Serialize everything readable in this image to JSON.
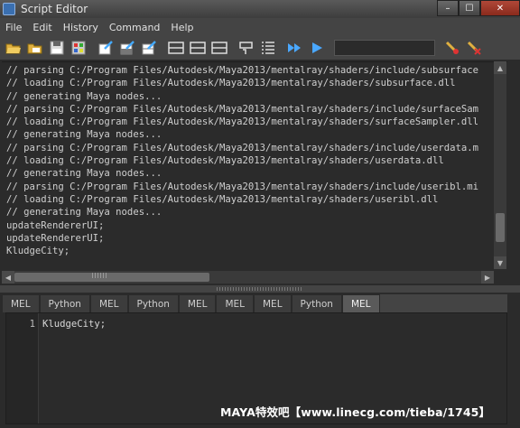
{
  "window": {
    "title": "Script Editor",
    "controls": [
      "–",
      "☐",
      "✕"
    ]
  },
  "menubar": [
    "File",
    "Edit",
    "History",
    "Command",
    "Help"
  ],
  "toolbar": {
    "icons": [
      "open-script-icon",
      "source-script-icon",
      "save-script-icon",
      "save-to-shelf-icon",
      "clear-history-icon",
      "clear-input-icon",
      "clear-all-icon",
      "show-history-only-icon",
      "show-input-only-icon",
      "show-both-icon",
      "echo-all-commands-icon",
      "show-line-numbers-icon",
      "execute-all-icon",
      "execute-icon",
      "search-field",
      "search-icon",
      "search-clear-icon"
    ]
  },
  "history": {
    "lines": [
      "// parsing C:/Program Files/Autodesk/Maya2013/mentalray/shaders/include/subsurface",
      "// loading C:/Program Files/Autodesk/Maya2013/mentalray/shaders/subsurface.dll",
      "// generating Maya nodes...",
      "// parsing C:/Program Files/Autodesk/Maya2013/mentalray/shaders/include/surfaceSam",
      "// loading C:/Program Files/Autodesk/Maya2013/mentalray/shaders/surfaceSampler.dll",
      "// generating Maya nodes...",
      "// parsing C:/Program Files/Autodesk/Maya2013/mentalray/shaders/include/userdata.m",
      "// loading C:/Program Files/Autodesk/Maya2013/mentalray/shaders/userdata.dll",
      "// generating Maya nodes...",
      "// parsing C:/Program Files/Autodesk/Maya2013/mentalray/shaders/include/useribl.mi",
      "// loading C:/Program Files/Autodesk/Maya2013/mentalray/shaders/useribl.dll",
      "// generating Maya nodes...",
      "updateRendererUI;",
      "updateRendererUI;",
      "KludgeCity;"
    ]
  },
  "tabs": [
    "MEL",
    "Python",
    "MEL",
    "Python",
    "MEL",
    "MEL",
    "MEL",
    "Python",
    "MEL"
  ],
  "active_tab_index": 8,
  "editor": {
    "line_number": "1",
    "code": "KludgeCity;"
  },
  "watermark": "MAYA特效吧【www.linecg.com/tieba/1745】"
}
